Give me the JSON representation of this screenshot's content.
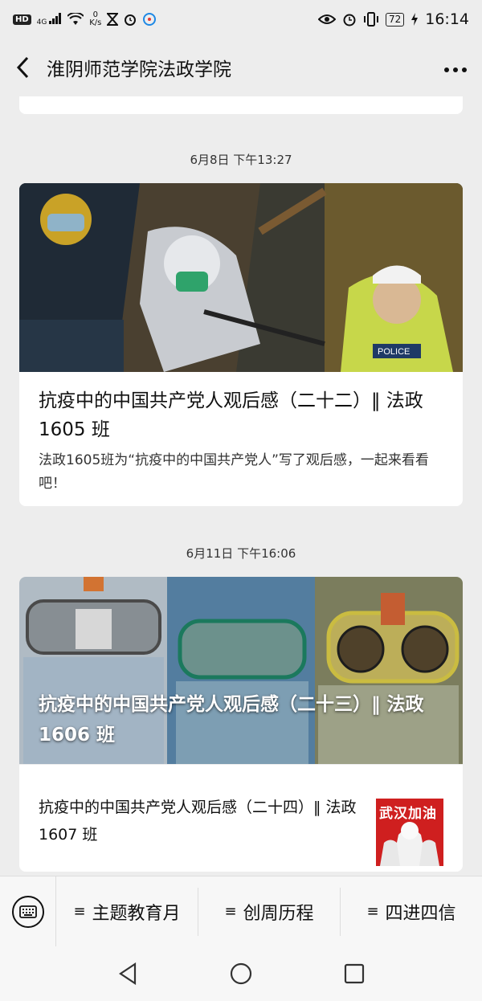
{
  "status": {
    "network": "HD",
    "signal": "4G",
    "speed_value": "0",
    "speed_unit": "K/s",
    "battery": "72",
    "time": "16:14"
  },
  "nav": {
    "title": "淮阴师范学院法政学院"
  },
  "feed": {
    "items": [
      {
        "timestamp": "6月8日 下午13:27",
        "title": "抗疫中的中国共产党人观后感（二十二）‖ 法政 1605 班",
        "description": "法政1605班为“抗疫中的中国共产党人”写了观后感，一起来看看吧！"
      },
      {
        "timestamp": "6月11日 下午16:06",
        "title": "抗疫中的中国共产党人观后感（二十三）‖ 法政 1606 班",
        "sub_title": "抗疫中的中国共产党人观后感（二十四）‖ 法政 1607 班",
        "thumb_text": "武汉加油"
      }
    ]
  },
  "bottom_menu": {
    "items": [
      "主题教育月",
      "创周历程",
      "四进四信"
    ]
  },
  "colors": {
    "background": "#ededed",
    "card": "#ffffff"
  }
}
